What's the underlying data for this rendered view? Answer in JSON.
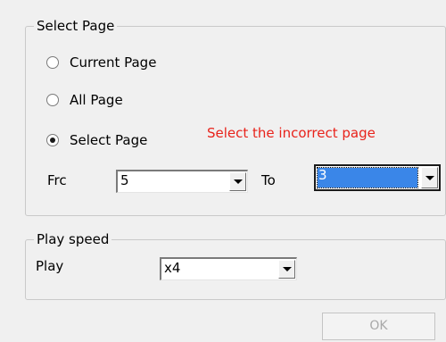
{
  "select_page_group": {
    "title": "Select Page",
    "options": [
      {
        "label": "Current Page",
        "checked": false
      },
      {
        "label": "All Page",
        "checked": false
      },
      {
        "label": "Select Page",
        "checked": true
      }
    ],
    "error_message": "Select the incorrect page",
    "error_color": "#e8231b",
    "from_label": "Frc",
    "from_value": "5",
    "to_label": "To",
    "to_value": "3"
  },
  "play_speed_group": {
    "title": "Play speed",
    "play_label": "Play",
    "play_value": "x4"
  },
  "ok_button": {
    "label": "OK",
    "enabled": false
  },
  "icons": {
    "dropdown": "chevron-down-icon",
    "radio": "radio-button-icon"
  }
}
